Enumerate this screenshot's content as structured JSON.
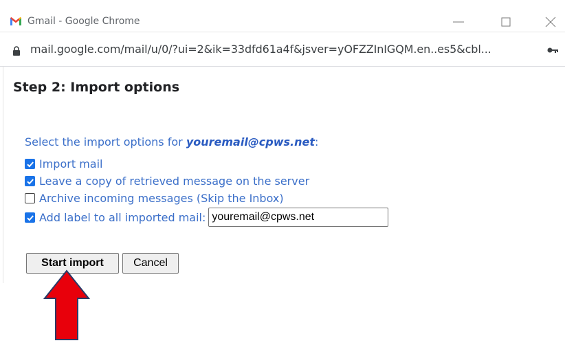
{
  "window": {
    "title": "Gmail - Google Chrome",
    "icon": "gmail-logo-icon"
  },
  "browser": {
    "url": "mail.google.com/mail/u/0/?ui=2&ik=33dfd61a4f&jsver=yOFZZInIGQM.en..es5&cbl...",
    "lock_icon": "lock-icon",
    "key_icon": "key-icon"
  },
  "page": {
    "title": "Step 2: Import options",
    "instructions_prefix": "Select the import options for ",
    "email": "youremail@cpws.net",
    "instructions_suffix": ":",
    "options": [
      {
        "label": "Import mail",
        "checked": true
      },
      {
        "label": "Leave a copy of retrieved message on the server",
        "checked": true
      },
      {
        "label": "Archive incoming messages (Skip the Inbox)",
        "checked": false
      },
      {
        "label": "Add label to all imported mail:",
        "checked": true
      }
    ],
    "label_value": "youremail@cpws.net",
    "start_button": "Start import",
    "cancel_button": "Cancel"
  },
  "colors": {
    "link_blue": "#3b6fc9",
    "checkbox_blue": "#1a73e8",
    "arrow_red": "#e8000b"
  }
}
